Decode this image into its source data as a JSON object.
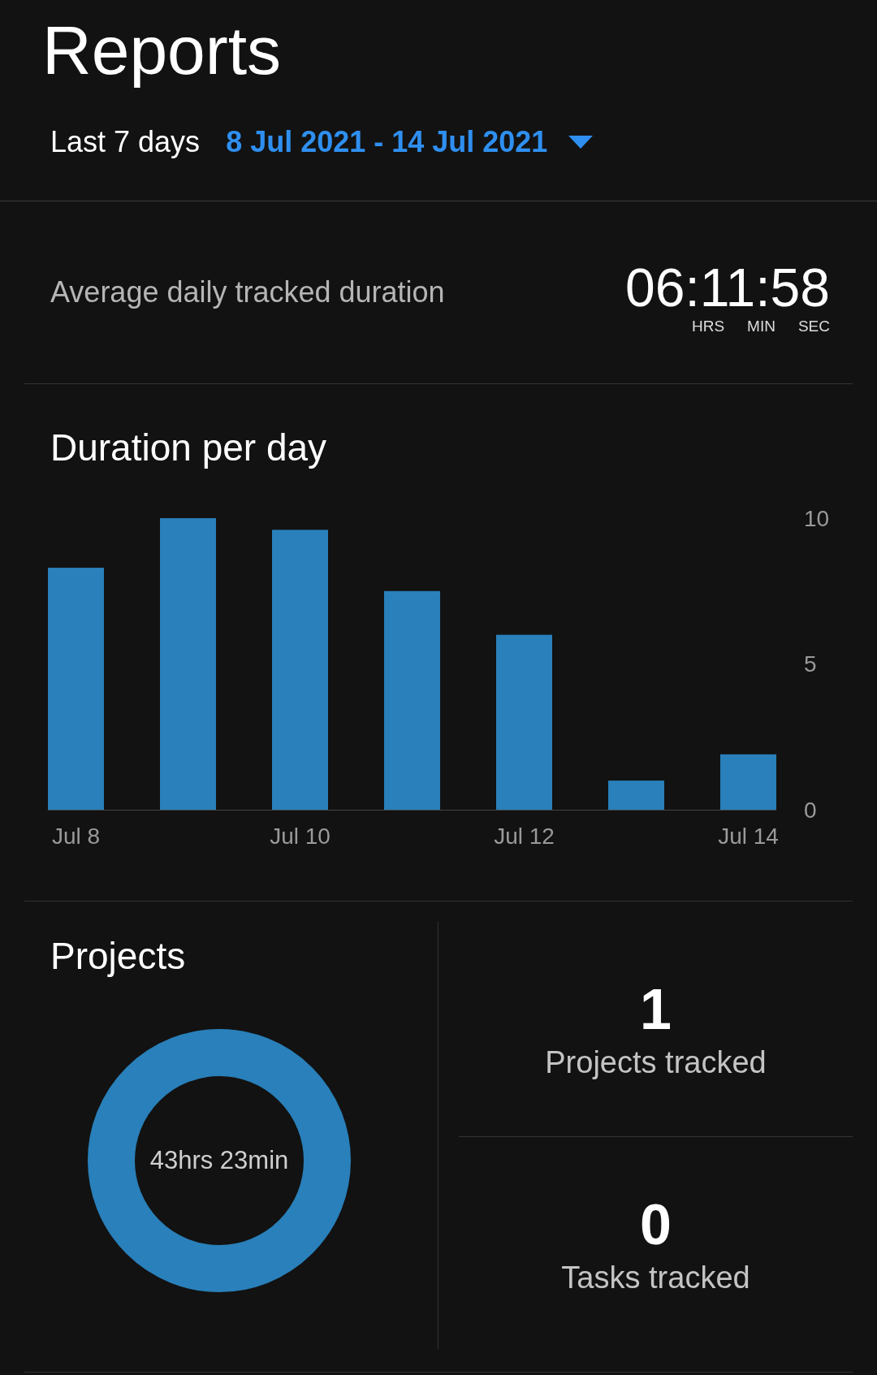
{
  "title": "Reports",
  "range": {
    "label": "Last 7 days",
    "dates": "8 Jul 2021 - 14 Jul 2021"
  },
  "average": {
    "label": "Average daily tracked duration",
    "time": "06:11:58",
    "units": [
      "HRS",
      "MIN",
      "SEC"
    ]
  },
  "duration_chart": {
    "title": "Duration per day",
    "chart_data": {
      "type": "bar",
      "categories": [
        "Jul 8",
        null,
        "Jul 10",
        null,
        "Jul 12",
        null,
        "Jul 14"
      ],
      "values": [
        8.3,
        10.0,
        9.6,
        7.5,
        6.0,
        1.0,
        1.9
      ],
      "ylim": [
        0,
        10
      ],
      "yticks": [
        0,
        5,
        10
      ]
    }
  },
  "projects": {
    "title": "Projects",
    "total": "43hrs 23min"
  },
  "stats": [
    {
      "value": "1",
      "label": "Projects tracked"
    },
    {
      "value": "0",
      "label": "Tasks tracked"
    }
  ]
}
